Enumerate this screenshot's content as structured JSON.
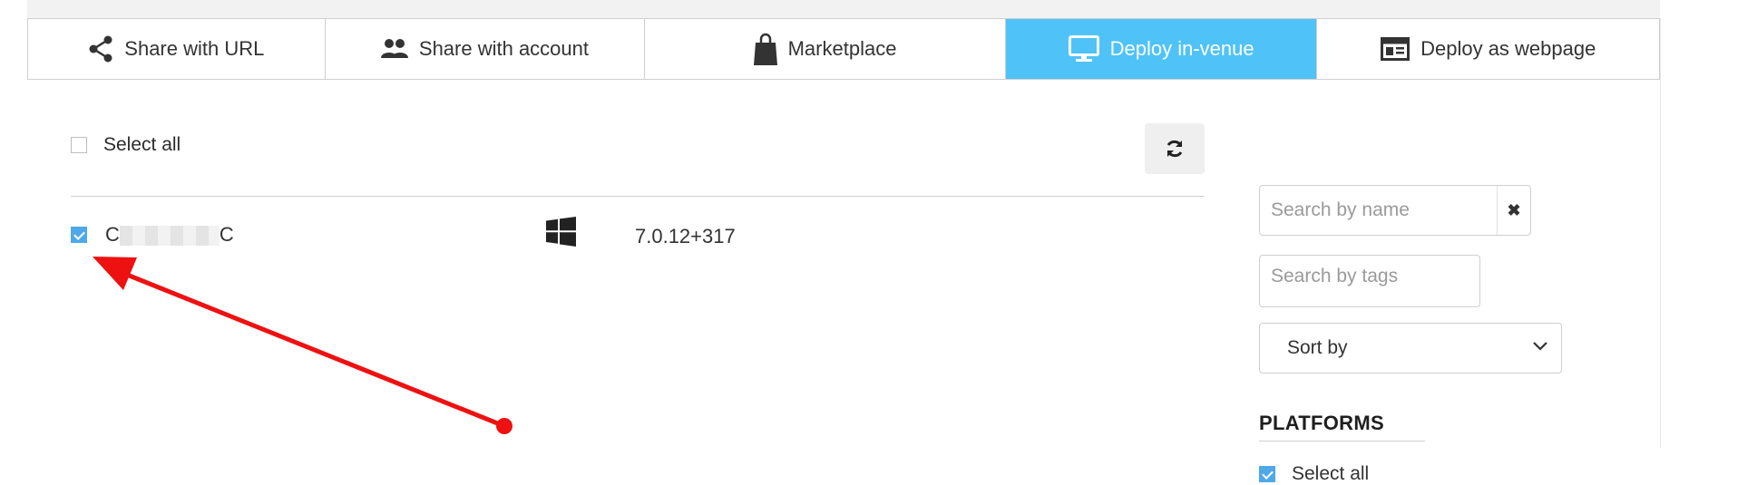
{
  "tabs": [
    {
      "label": "Share with URL",
      "icon": "share-icon",
      "active": false
    },
    {
      "label": "Share with account",
      "icon": "users-icon",
      "active": false
    },
    {
      "label": "Marketplace",
      "icon": "shopping-bag-icon",
      "active": false
    },
    {
      "label": "Deploy in-venue",
      "icon": "monitor-icon",
      "active": true
    },
    {
      "label": "Deploy as webpage",
      "icon": "browser-window-icon",
      "active": false
    }
  ],
  "list": {
    "select_all_label": "Select all",
    "select_all_checked": false,
    "rows": [
      {
        "name_start": "C",
        "name_end": "C",
        "checked": true,
        "platform_icon": "windows-icon",
        "version": "7.0.12+317"
      }
    ]
  },
  "sidebar": {
    "search_name_placeholder": "Search by name",
    "clear_symbol": "✖",
    "search_tags_placeholder": "Search by tags",
    "sort_label": "Sort by",
    "platforms_title": "PLATFORMS",
    "platforms_select_all_label": "Select all",
    "platforms_select_all_checked": true
  },
  "colors": {
    "accent": "#4fc3f7",
    "checkbox": "#4fa8e8",
    "arrow": "#ee1111"
  }
}
